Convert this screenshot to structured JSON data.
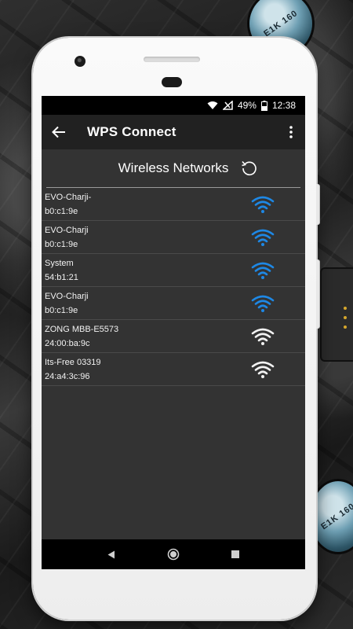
{
  "status_bar": {
    "battery": "49%",
    "time": "12:38",
    "icons": [
      "wifi-signal-icon",
      "cellular-no-signal-icon",
      "battery-icon"
    ]
  },
  "app_bar": {
    "title": "WPS Connect",
    "back_icon": "arrow-back-icon",
    "menu_icon": "more-vert-icon"
  },
  "section": {
    "title": "Wireless Networks",
    "refresh_icon": "refresh-icon"
  },
  "networks": [
    {
      "ssid": "EVO-Charji-",
      "bssid": "b0:c1:9e",
      "icon": "wifi-icon",
      "color": "#1e88e5"
    },
    {
      "ssid": "EVO-Charji",
      "bssid": "b0:c1:9e",
      "icon": "wifi-icon",
      "color": "#1e88e5"
    },
    {
      "ssid": "System",
      "bssid": "54:b1:21",
      "icon": "wifi-icon",
      "color": "#1e88e5"
    },
    {
      "ssid": "EVO-Charji",
      "bssid": "b0:c1:9e",
      "icon": "wifi-icon",
      "color": "#1e88e5"
    },
    {
      "ssid": "ZONG MBB-E5573",
      "bssid": "24:00:ba:9c",
      "icon": "wifi-icon",
      "color": "#f2f2f2"
    },
    {
      "ssid": "Its-Free 03319",
      "bssid": "24:a4:3c:96",
      "icon": "wifi-icon",
      "color": "#f2f2f2"
    }
  ],
  "nav_bar": {
    "icons": [
      "nav-back-icon",
      "nav-home-icon",
      "nav-recents-icon"
    ]
  },
  "colors": {
    "secure_wps": "#1e88e5",
    "open": "#f2f2f2",
    "app_bar": "#212121",
    "screen_bg": "#333333"
  },
  "background_decor": {
    "capacitor_label_1": "E1K 160",
    "capacitor_label_2": "E1K 160"
  }
}
